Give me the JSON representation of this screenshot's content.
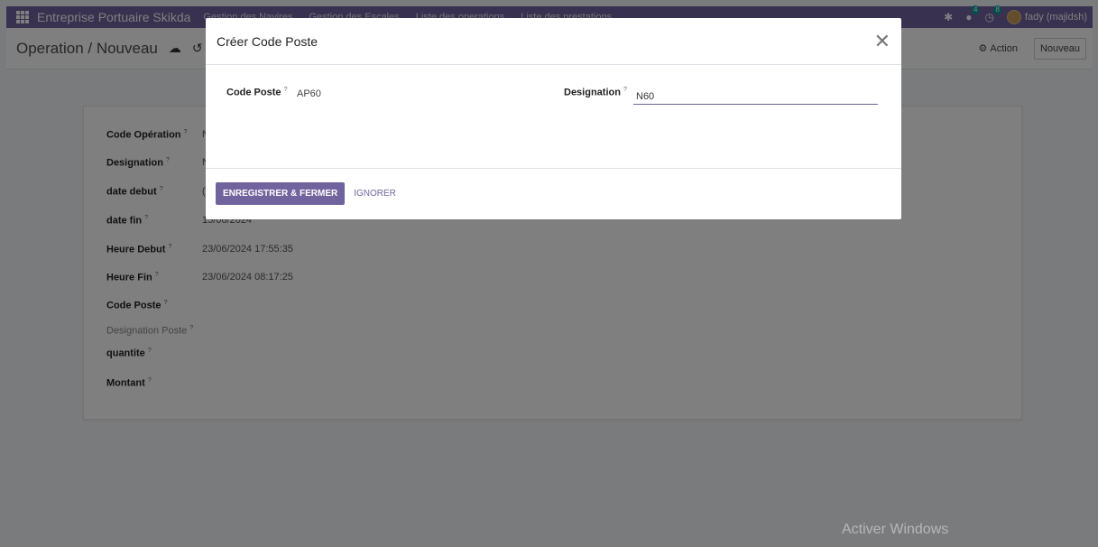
{
  "navbar": {
    "apps_icon": "apps-grid-icon",
    "brand": "Entreprise Portuaire Skikda",
    "menu": [
      "Gestion des Navires",
      "Gestion des Escales",
      "Liste des operations",
      "Liste des prestations"
    ],
    "bug_icon": "bug-icon",
    "messages_icon": "chat-icon",
    "messages_count": "4",
    "activities_icon": "clock-icon",
    "activities_count": "8",
    "user_name": "fady (majidsh)"
  },
  "control": {
    "breadcrumb": "Operation / Nouveau",
    "save_icon": "cloud-upload-icon",
    "discard_icon": "undo-icon",
    "action_label": "Action",
    "action_icon": "gear-icon",
    "new_label": "Nouveau"
  },
  "form": {
    "fields": [
      {
        "label": "Code Opération",
        "help": "?",
        "value": "N"
      },
      {
        "label": "Designation",
        "help": "?",
        "value": "N"
      },
      {
        "label": "date debut",
        "help": "?",
        "value": "("
      },
      {
        "label": "date fin",
        "help": "?",
        "value": "15/06/2024"
      },
      {
        "label": "Heure Debut",
        "help": "?",
        "value": "23/06/2024 17:55:35"
      },
      {
        "label": "Heure Fin",
        "help": "?",
        "value": "23/06/2024 08:17:25"
      },
      {
        "label": "Code Poste",
        "help": "?",
        "value": ""
      },
      {
        "label": "Designation Poste",
        "help": "?",
        "value": ""
      },
      {
        "label": "quantite",
        "help": "?",
        "value": ""
      },
      {
        "label": "Montant",
        "help": "?",
        "value": ""
      }
    ]
  },
  "modal": {
    "title": "Créer Code Poste",
    "close_icon": "close-icon",
    "code_poste_label": "Code Poste",
    "code_poste_help": "?",
    "code_poste_value": "AP60",
    "designation_label": "Designation",
    "designation_help": "?",
    "designation_value": "N60",
    "save_label": "ENREGISTRER & FERMER",
    "discard_label": "IGNORER"
  },
  "watermark": "Activer Windows",
  "colors": {
    "brand": "#71639e",
    "badge": "#00a09d"
  }
}
